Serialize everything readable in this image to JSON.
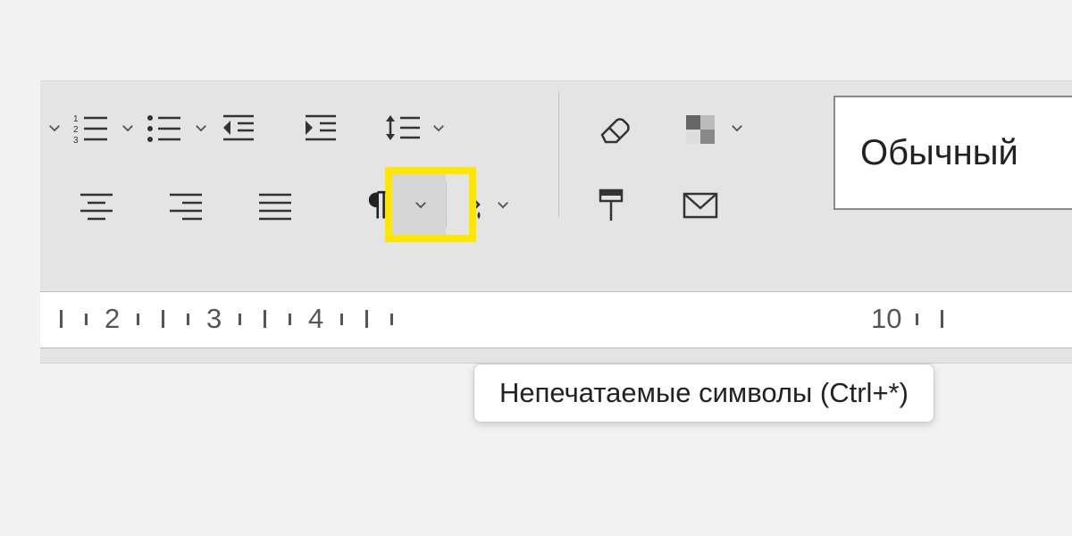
{
  "toolbar": {
    "row1": {
      "numbered_list": "numbered-list",
      "bulleted_list": "bulleted-list",
      "decrease_indent": "decrease-indent",
      "increase_indent": "increase-indent",
      "line_spacing": "line-spacing",
      "eraser": "eraser",
      "color_theme": "color-theme"
    },
    "row2": {
      "align_center": "align-center",
      "align_right": "align-right",
      "align_justify": "align-justify",
      "formatting_marks": "formatting-marks",
      "paint_bucket": "paint-bucket",
      "format_paint": "format-paint",
      "mail_merge": "mail-merge"
    },
    "tooltip_text": "Непечатаемые символы (Ctrl+*)",
    "style_label": "Обычный"
  },
  "ruler": {
    "labels": [
      "2",
      "3",
      "4",
      "10"
    ]
  }
}
